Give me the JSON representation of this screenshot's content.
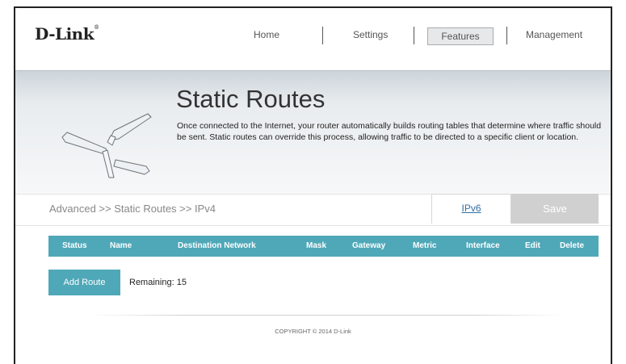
{
  "brand": {
    "logo_text": "D-Link"
  },
  "nav": {
    "items": [
      {
        "label": "Home"
      },
      {
        "label": "Settings"
      },
      {
        "label": "Features"
      },
      {
        "label": "Management"
      }
    ],
    "active": "Features"
  },
  "hero": {
    "title": "Static Routes",
    "description": "Once connected to the Internet, your router automatically builds routing tables that determine where traffic should be sent. Static routes can override this process, allowing traffic to be directed to a specific client or location.",
    "icon": "signpost-icon"
  },
  "breadcrumb": {
    "text": "Advanced >> Static Routes >> IPv4"
  },
  "toolbar": {
    "ipv6_label": "IPv6",
    "save_label": "Save"
  },
  "table": {
    "columns": [
      "Status",
      "Name",
      "Destination Network",
      "Mask",
      "Gateway",
      "Metric",
      "Interface",
      "Edit",
      "Delete"
    ],
    "rows": []
  },
  "routes": {
    "add_label": "Add Route",
    "remaining_label": "Remaining: 15"
  },
  "footer": {
    "copyright": "COPYRIGHT © 2014 D-Link"
  },
  "colors": {
    "accent": "#4fa8b8",
    "save_disabled": "#d0d0d0",
    "link": "#2d6fa8"
  }
}
